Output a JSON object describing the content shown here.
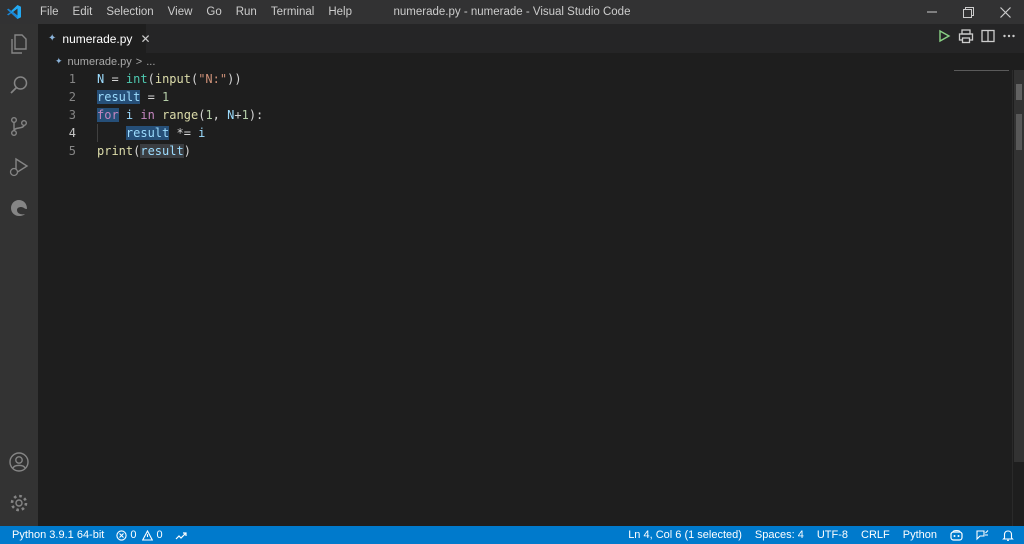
{
  "window": {
    "title": "numerade.py - numerade - Visual Studio Code",
    "menu": [
      "File",
      "Edit",
      "Selection",
      "View",
      "Go",
      "Run",
      "Terminal",
      "Help"
    ]
  },
  "tab": {
    "label": "numerade.py",
    "close_glyph": "✕"
  },
  "breadcrumb": {
    "file": "numerade.py",
    "separator": ">",
    "rest": "..."
  },
  "editor": {
    "lines": [
      {
        "num": "1"
      },
      {
        "num": "2"
      },
      {
        "num": "3"
      },
      {
        "num": "4"
      },
      {
        "num": "5"
      }
    ],
    "tokens": {
      "l1_N": "N",
      "l1_eq": " = ",
      "l1_int": "int",
      "l1_p1": "(",
      "l1_input": "input",
      "l1_p2": "(",
      "l1_str": "\"N:\"",
      "l1_p3": "))",
      "l2_result": "result",
      "l2_eq": " = ",
      "l2_one": "1",
      "l3_for": "for",
      "l3_i": "i",
      "l3_in": "in",
      "l3_range": "range",
      "l3_open": "(",
      "l3_one": "1",
      "l3_comma": ", ",
      "l3_N": "N",
      "l3_plus": "+",
      "l3_one2": "1",
      "l3_close": "):",
      "l4_indent": "    ",
      "l4_result": "result",
      "l4_op": " *= ",
      "l4_i": "i",
      "l5_print": "print",
      "l5_open": "(",
      "l5_result": "result",
      "l5_close": ")"
    },
    "active_line": 4
  },
  "statusbar": {
    "interpreter": "Python 3.9.1 64-bit",
    "errors": "0",
    "warnings": "0",
    "position": "Ln 4, Col 6 (1 selected)",
    "spaces": "Spaces: 4",
    "encoding": "UTF-8",
    "eol": "CRLF",
    "language": "Python"
  },
  "colors": {
    "accent": "#007acc",
    "keyword": "#569cd6",
    "function": "#dcdcaa",
    "string": "#ce9178",
    "number": "#b5cea8",
    "selection": "#264f78"
  },
  "icons": {
    "activity": [
      "explorer-icon",
      "search-icon",
      "source-control-icon",
      "run-debug-icon",
      "edge-icon",
      "account-icon",
      "settings-gear-icon"
    ],
    "editor_actions": [
      "run-icon",
      "print-icon",
      "split-editor-icon",
      "more-actions-icon"
    ]
  }
}
